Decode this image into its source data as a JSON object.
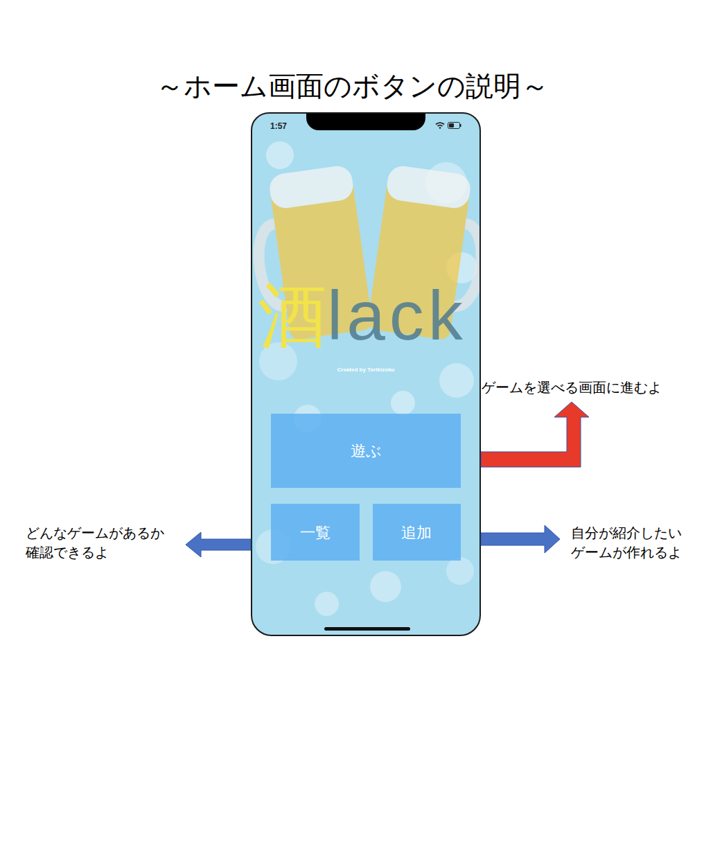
{
  "title": "～ホーム画面のボタンの説明～",
  "phone": {
    "status_bar": {
      "time": "1:57"
    },
    "logo": {
      "kanji": "酒",
      "latin": "lack"
    },
    "credit": "Created by Torikizoku",
    "buttons": [
      {
        "label": "遊ぶ"
      },
      {
        "label": "一覧"
      },
      {
        "label": "追加"
      }
    ]
  },
  "annotations": [
    {
      "lines": [
        "ゲームを選べる画面に進むよ"
      ],
      "color": "#e83a2a"
    },
    {
      "lines": [
        "どんなゲームがあるか",
        "確認できるよ"
      ],
      "color": "#4a72c4"
    },
    {
      "lines": [
        "自分が紹介したい",
        "ゲームが作れるよ"
      ],
      "color": "#4a72c4"
    }
  ]
}
